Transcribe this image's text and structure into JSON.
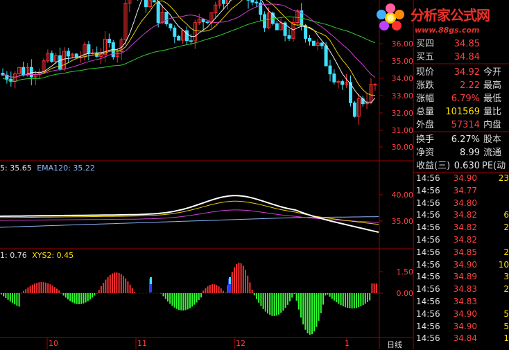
{
  "watermark": {
    "title": "分析家公式网",
    "url": "www.88gs.com"
  },
  "indicator_ma": {
    "prefix": "5: 35.65",
    "ema_label": "EMA120: 35.22"
  },
  "indicator_xys": {
    "xys1": "1: 0.76",
    "xys2": "XYS2: 0.45"
  },
  "axis_main": [
    "36.00",
    "35.00",
    "34.00",
    "33.00",
    "32.00",
    "31.00",
    "30.00"
  ],
  "axis_mid": [
    "40.00",
    "35.00"
  ],
  "axis_bottom": [
    "1.50",
    "0.00"
  ],
  "x_labels": [
    "10",
    "11",
    "12",
    "1"
  ],
  "period_label": "日线",
  "quote": {
    "buy4_label": "买四",
    "buy4": "34.85",
    "buy5_label": "买五",
    "buy5": "34.84",
    "price_label": "现价",
    "price": "34.92",
    "open_label": "今开",
    "change_label": "涨跌",
    "change": "2.22",
    "high_label": "最高",
    "pct_label": "涨幅",
    "pct": "6.79%",
    "low_label": "最低",
    "volume_label": "总量",
    "volume": "101569",
    "ratio_label": "量比",
    "outer_label": "外盘",
    "outer": "57314",
    "inner_label": "内盘",
    "turnover_label": "换手",
    "turnover": "6.27%",
    "equity_label": "股本",
    "nav_label": "净资",
    "nav": "8.99",
    "float_label": "流通",
    "eps_label": "收益(三)",
    "eps": "0.630",
    "pe_label": "PE(动"
  },
  "ticks": [
    {
      "time": "14:56",
      "price": "34.90",
      "vol": "23"
    },
    {
      "time": "14:56",
      "price": "34.77",
      "vol": ""
    },
    {
      "time": "14:56",
      "price": "34.80",
      "vol": ""
    },
    {
      "time": "14:56",
      "price": "34.82",
      "vol": "6"
    },
    {
      "time": "14:56",
      "price": "34.82",
      "vol": "2"
    },
    {
      "time": "14:56",
      "price": "34.82",
      "vol": ""
    },
    {
      "time": "14:56",
      "price": "34.85",
      "vol": "2"
    },
    {
      "time": "14:56",
      "price": "34.90",
      "vol": "10"
    },
    {
      "time": "14:56",
      "price": "34.89",
      "vol": "3"
    },
    {
      "time": "14:56",
      "price": "34.83",
      "vol": "2"
    },
    {
      "time": "14:56",
      "price": "34.83",
      "vol": ""
    },
    {
      "time": "14:56",
      "price": "34.90",
      "vol": "5"
    },
    {
      "time": "14:56",
      "price": "34.90",
      "vol": "5"
    },
    {
      "time": "14:56",
      "price": "34.84",
      "vol": "1"
    }
  ],
  "colors": {
    "up": "#ff3030",
    "down": "#40e0ff",
    "green_bar": "#30ff30",
    "grid": "#a00000"
  }
}
